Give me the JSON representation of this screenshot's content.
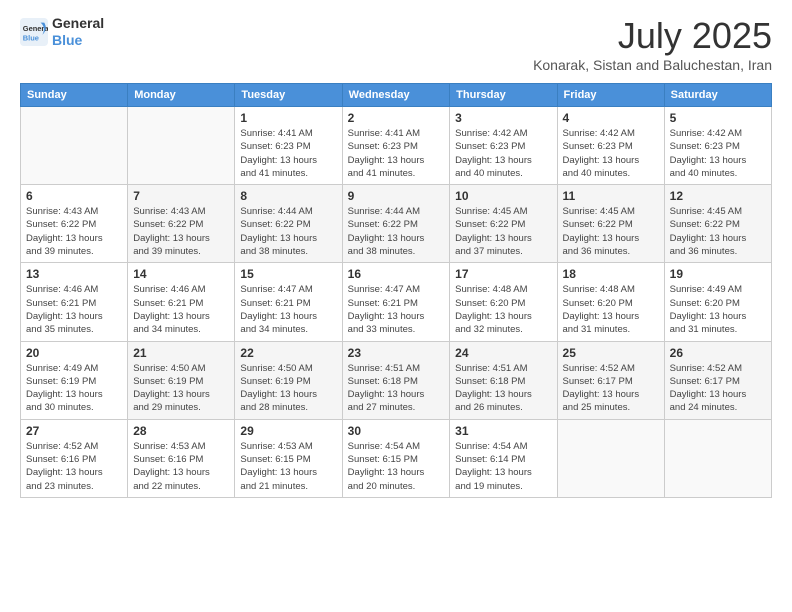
{
  "logo": {
    "line1": "General",
    "line2": "Blue"
  },
  "title": {
    "month_year": "July 2025",
    "location": "Konarak, Sistan and Baluchestan, Iran"
  },
  "headers": [
    "Sunday",
    "Monday",
    "Tuesday",
    "Wednesday",
    "Thursday",
    "Friday",
    "Saturday"
  ],
  "weeks": [
    [
      {
        "day": "",
        "info": ""
      },
      {
        "day": "",
        "info": ""
      },
      {
        "day": "1",
        "info": "Sunrise: 4:41 AM\nSunset: 6:23 PM\nDaylight: 13 hours\nand 41 minutes."
      },
      {
        "day": "2",
        "info": "Sunrise: 4:41 AM\nSunset: 6:23 PM\nDaylight: 13 hours\nand 41 minutes."
      },
      {
        "day": "3",
        "info": "Sunrise: 4:42 AM\nSunset: 6:23 PM\nDaylight: 13 hours\nand 40 minutes."
      },
      {
        "day": "4",
        "info": "Sunrise: 4:42 AM\nSunset: 6:23 PM\nDaylight: 13 hours\nand 40 minutes."
      },
      {
        "day": "5",
        "info": "Sunrise: 4:42 AM\nSunset: 6:23 PM\nDaylight: 13 hours\nand 40 minutes."
      }
    ],
    [
      {
        "day": "6",
        "info": "Sunrise: 4:43 AM\nSunset: 6:22 PM\nDaylight: 13 hours\nand 39 minutes."
      },
      {
        "day": "7",
        "info": "Sunrise: 4:43 AM\nSunset: 6:22 PM\nDaylight: 13 hours\nand 39 minutes."
      },
      {
        "day": "8",
        "info": "Sunrise: 4:44 AM\nSunset: 6:22 PM\nDaylight: 13 hours\nand 38 minutes."
      },
      {
        "day": "9",
        "info": "Sunrise: 4:44 AM\nSunset: 6:22 PM\nDaylight: 13 hours\nand 38 minutes."
      },
      {
        "day": "10",
        "info": "Sunrise: 4:45 AM\nSunset: 6:22 PM\nDaylight: 13 hours\nand 37 minutes."
      },
      {
        "day": "11",
        "info": "Sunrise: 4:45 AM\nSunset: 6:22 PM\nDaylight: 13 hours\nand 36 minutes."
      },
      {
        "day": "12",
        "info": "Sunrise: 4:45 AM\nSunset: 6:22 PM\nDaylight: 13 hours\nand 36 minutes."
      }
    ],
    [
      {
        "day": "13",
        "info": "Sunrise: 4:46 AM\nSunset: 6:21 PM\nDaylight: 13 hours\nand 35 minutes."
      },
      {
        "day": "14",
        "info": "Sunrise: 4:46 AM\nSunset: 6:21 PM\nDaylight: 13 hours\nand 34 minutes."
      },
      {
        "day": "15",
        "info": "Sunrise: 4:47 AM\nSunset: 6:21 PM\nDaylight: 13 hours\nand 34 minutes."
      },
      {
        "day": "16",
        "info": "Sunrise: 4:47 AM\nSunset: 6:21 PM\nDaylight: 13 hours\nand 33 minutes."
      },
      {
        "day": "17",
        "info": "Sunrise: 4:48 AM\nSunset: 6:20 PM\nDaylight: 13 hours\nand 32 minutes."
      },
      {
        "day": "18",
        "info": "Sunrise: 4:48 AM\nSunset: 6:20 PM\nDaylight: 13 hours\nand 31 minutes."
      },
      {
        "day": "19",
        "info": "Sunrise: 4:49 AM\nSunset: 6:20 PM\nDaylight: 13 hours\nand 31 minutes."
      }
    ],
    [
      {
        "day": "20",
        "info": "Sunrise: 4:49 AM\nSunset: 6:19 PM\nDaylight: 13 hours\nand 30 minutes."
      },
      {
        "day": "21",
        "info": "Sunrise: 4:50 AM\nSunset: 6:19 PM\nDaylight: 13 hours\nand 29 minutes."
      },
      {
        "day": "22",
        "info": "Sunrise: 4:50 AM\nSunset: 6:19 PM\nDaylight: 13 hours\nand 28 minutes."
      },
      {
        "day": "23",
        "info": "Sunrise: 4:51 AM\nSunset: 6:18 PM\nDaylight: 13 hours\nand 27 minutes."
      },
      {
        "day": "24",
        "info": "Sunrise: 4:51 AM\nSunset: 6:18 PM\nDaylight: 13 hours\nand 26 minutes."
      },
      {
        "day": "25",
        "info": "Sunrise: 4:52 AM\nSunset: 6:17 PM\nDaylight: 13 hours\nand 25 minutes."
      },
      {
        "day": "26",
        "info": "Sunrise: 4:52 AM\nSunset: 6:17 PM\nDaylight: 13 hours\nand 24 minutes."
      }
    ],
    [
      {
        "day": "27",
        "info": "Sunrise: 4:52 AM\nSunset: 6:16 PM\nDaylight: 13 hours\nand 23 minutes."
      },
      {
        "day": "28",
        "info": "Sunrise: 4:53 AM\nSunset: 6:16 PM\nDaylight: 13 hours\nand 22 minutes."
      },
      {
        "day": "29",
        "info": "Sunrise: 4:53 AM\nSunset: 6:15 PM\nDaylight: 13 hours\nand 21 minutes."
      },
      {
        "day": "30",
        "info": "Sunrise: 4:54 AM\nSunset: 6:15 PM\nDaylight: 13 hours\nand 20 minutes."
      },
      {
        "day": "31",
        "info": "Sunrise: 4:54 AM\nSunset: 6:14 PM\nDaylight: 13 hours\nand 19 minutes."
      },
      {
        "day": "",
        "info": ""
      },
      {
        "day": "",
        "info": ""
      }
    ]
  ]
}
